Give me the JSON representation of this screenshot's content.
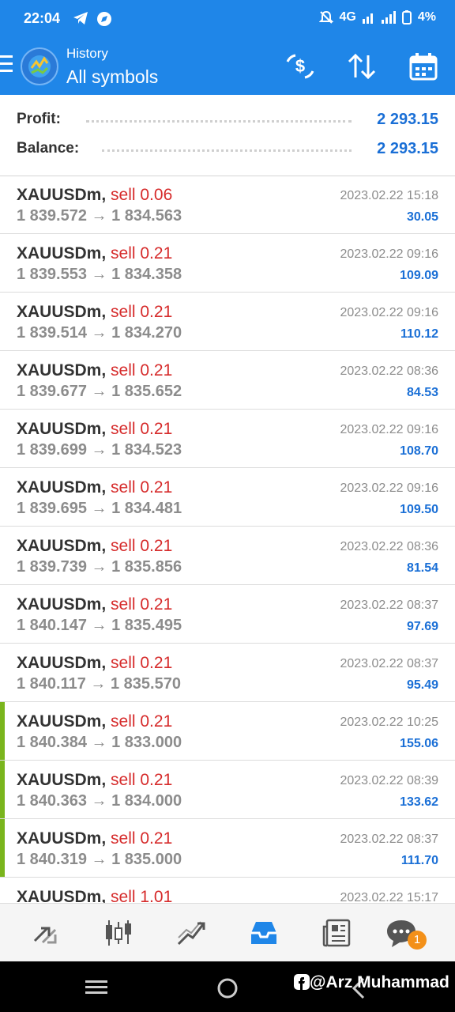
{
  "status_bar": {
    "time": "22:04",
    "network": "4G",
    "battery": "4%"
  },
  "header": {
    "subtitle": "History",
    "title": "All symbols"
  },
  "summary": {
    "profit_label": "Profit:",
    "profit_value": "2 293.15",
    "balance_label": "Balance:",
    "balance_value": "2 293.15"
  },
  "trades": [
    {
      "symbol": "XAUUSDm,",
      "side": "sell 0.06",
      "prices": "1 839.572 → 1 834.563",
      "time": "2023.02.22 15:18",
      "profit": "30.05"
    },
    {
      "symbol": "XAUUSDm,",
      "side": "sell 0.21",
      "prices": "1 839.553 → 1 834.358",
      "time": "2023.02.22 09:16",
      "profit": "109.09"
    },
    {
      "symbol": "XAUUSDm,",
      "side": "sell 0.21",
      "prices": "1 839.514 → 1 834.270",
      "time": "2023.02.22 09:16",
      "profit": "110.12"
    },
    {
      "symbol": "XAUUSDm,",
      "side": "sell 0.21",
      "prices": "1 839.677 → 1 835.652",
      "time": "2023.02.22 08:36",
      "profit": "84.53"
    },
    {
      "symbol": "XAUUSDm,",
      "side": "sell 0.21",
      "prices": "1 839.699 → 1 834.523",
      "time": "2023.02.22 09:16",
      "profit": "108.70"
    },
    {
      "symbol": "XAUUSDm,",
      "side": "sell 0.21",
      "prices": "1 839.695 → 1 834.481",
      "time": "2023.02.22 09:16",
      "profit": "109.50"
    },
    {
      "symbol": "XAUUSDm,",
      "side": "sell 0.21",
      "prices": "1 839.739 → 1 835.856",
      "time": "2023.02.22 08:36",
      "profit": "81.54"
    },
    {
      "symbol": "XAUUSDm,",
      "side": "sell 0.21",
      "prices": "1 840.147 → 1 835.495",
      "time": "2023.02.22 08:37",
      "profit": "97.69"
    },
    {
      "symbol": "XAUUSDm,",
      "side": "sell 0.21",
      "prices": "1 840.117 → 1 835.570",
      "time": "2023.02.22 08:37",
      "profit": "95.49"
    },
    {
      "symbol": "XAUUSDm,",
      "side": "sell 0.21",
      "prices": "1 840.384 → 1 833.000",
      "time": "2023.02.22 10:25",
      "profit": "155.06"
    },
    {
      "symbol": "XAUUSDm,",
      "side": "sell 0.21",
      "prices": "1 840.363 → 1 834.000",
      "time": "2023.02.22 08:39",
      "profit": "133.62"
    },
    {
      "symbol": "XAUUSDm,",
      "side": "sell 0.21",
      "prices": "1 840.319 → 1 835.000",
      "time": "2023.02.22 08:37",
      "profit": "111.70"
    },
    {
      "symbol": "XAUUSDm,",
      "side": "sell 1.01",
      "prices": "",
      "time": "2023.02.22 15:17",
      "profit": ""
    }
  ],
  "bottom_nav": {
    "icons": [
      "quotes-icon",
      "chart-icon",
      "trade-icon",
      "history-icon",
      "news-icon",
      "chat-icon"
    ],
    "chat_badge": "1"
  },
  "watermark": "@Arz Muhammad",
  "colors": {
    "accent": "#1f86e8",
    "profit": "#1a6fd6",
    "sell": "#d62b2b",
    "tp_marker": "#7ab51d"
  }
}
